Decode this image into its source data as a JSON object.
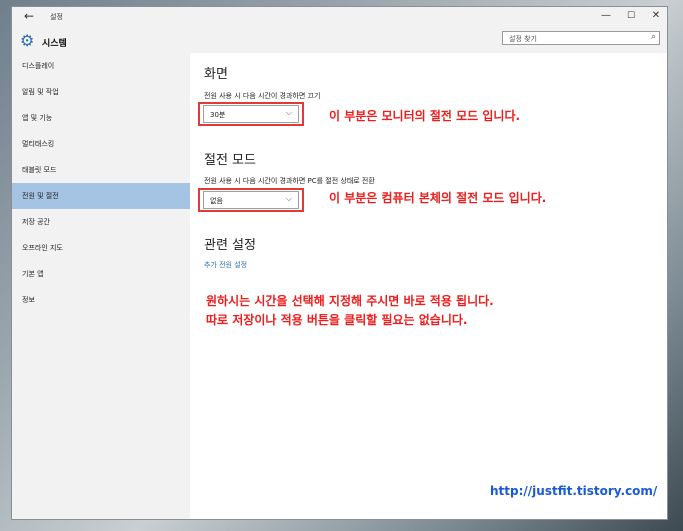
{
  "window": {
    "title": "설정",
    "minimize": "—",
    "maximize": "☐",
    "close": "✕",
    "back": "←"
  },
  "header": {
    "title": "시스템",
    "search_placeholder": "설정 찾기",
    "gear_icon": "⚙",
    "search_icon": "⌕"
  },
  "sidebar": {
    "items": [
      {
        "label": "디스플레이"
      },
      {
        "label": "알림 및 작업"
      },
      {
        "label": "앱 및 기능"
      },
      {
        "label": "멀티태스킹"
      },
      {
        "label": "태블릿 모드"
      },
      {
        "label": "전원 및 절전",
        "selected": true
      },
      {
        "label": "저장 공간"
      },
      {
        "label": "오프라인 지도"
      },
      {
        "label": "기본 앱"
      },
      {
        "label": "정보"
      }
    ]
  },
  "main": {
    "screen": {
      "heading": "화면",
      "label": "전원 사용 시 다음 시간이 경과하면 끄기",
      "value": "30분"
    },
    "sleep": {
      "heading": "절전 모드",
      "label": "전원 사용 시 다음 시간이 경과하면 PC를 절전 상태로 전환",
      "value": "없음"
    },
    "related": {
      "heading": "관련 설정",
      "link": "추가 전원 설정"
    }
  },
  "annotations": {
    "monitor": "이 부분은 모니터의 절전 모드 입니다.",
    "computer": "이 부분은 컴퓨터 본체의 절전 모드 입니다.",
    "note_line1": "원하시는 시간을 선택해 지정해 주시면 바로 적용 됩니다.",
    "note_line2": "따로 저장이나 적용 버튼을 클릭할 필요는 없습니다.",
    "url": "http://justfit.tistory.com/"
  },
  "colors": {
    "accent": "#2d6fb0",
    "selected": "#a5c3e2",
    "annotation": "#ee1c1c",
    "url": "#1a5ad6"
  }
}
